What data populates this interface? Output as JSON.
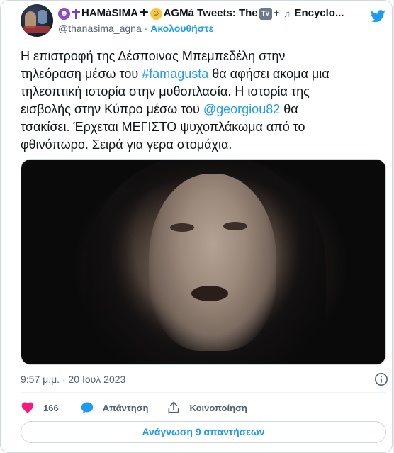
{
  "author": {
    "name_parts": [
      "HAMàSIMA",
      "AGMá Tweets: The",
      "Encyclo..."
    ],
    "handle": "@thanasima_agna",
    "separator": "·",
    "follow_label": "Ακολουθήστε"
  },
  "emoji_icons": [
    "devil-emoji-icon",
    "cross-emoji-icon",
    "angel-emoji-icon",
    "tv-emoji-icon",
    "plus-sign",
    "music-notes-emoji-icon"
  ],
  "tweet": {
    "lines": [
      [
        {
          "text": "Η επιστροφή της Δέσποινας Μπεμπεδέλη στην",
          "link": false
        }
      ],
      [
        {
          "text": "τηλεόραση μέσω του ",
          "link": false
        },
        {
          "text": "#famagusta",
          "link": true
        },
        {
          "text": " θα αφήσει ακομα μια",
          "link": false
        }
      ],
      [
        {
          "text": "τηλεοπτική ιστορία στην μυθοπλασία. Η ιστορία της",
          "link": false
        }
      ],
      [
        {
          "text": "εισβολής στην Κύπρο μέσω του ",
          "link": false
        },
        {
          "text": "@georgiou82",
          "link": true
        },
        {
          "text": " θα",
          "link": false
        }
      ],
      [
        {
          "text": "τσακίσει. Έρχεται ΜΕΓΙΣΤΟ ψυχοπλάκωμα από το",
          "link": false
        }
      ],
      [
        {
          "text": "φθινόπωρο. Σειρά για γερα στομάχια.",
          "link": false
        }
      ]
    ],
    "timestamp": "9:57 μ.μ. · 20 Ιουλ 2023"
  },
  "actions": {
    "like_count": "166",
    "reply_label": "Απάντηση",
    "share_label": "Κοινοποίηση"
  },
  "read_replies_label": "Ανάγνωση 9 απαντήσεων",
  "colors": {
    "accent": "#1d9bf0",
    "heart": "#f91880",
    "text": "#0f1419",
    "muted": "#536471",
    "border": "#cfd9de"
  }
}
